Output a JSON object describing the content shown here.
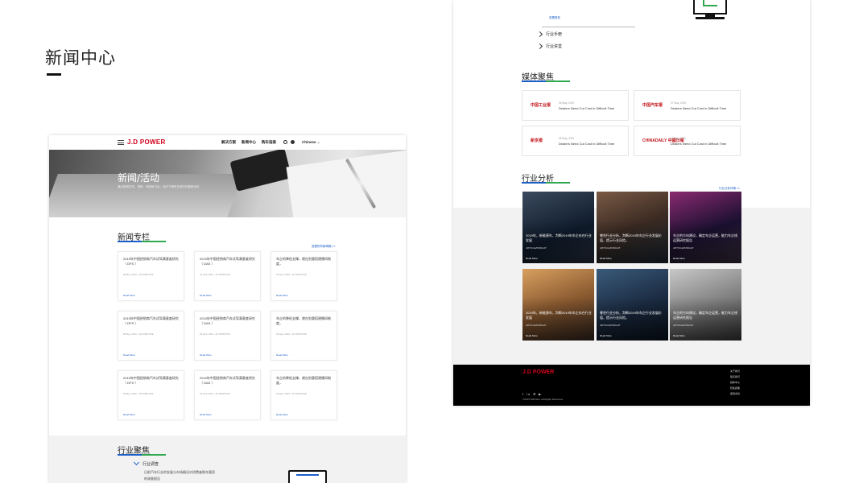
{
  "page": {
    "title": "新闻中心"
  },
  "left": {
    "nav": {
      "logo": "J.D POWER",
      "links": [
        "解决方案",
        "新闻中心",
        "购车指南"
      ],
      "lang": "Chinese"
    },
    "hero": {
      "title": "新闻/活动",
      "subtitle": "通过新闻发布，调研，网络研讨会，及时了解有关我们的最新动态"
    },
    "column": {
      "title": "新闻专栏",
      "more": "查看所有新闻稿 >>",
      "cards": [
        {
          "title": "2019年中国经销商汽车试驾满意度研究（ DFS ）",
          "date": "08 May, 2019 · AUTOMOTIVE",
          "read": "Read More"
        },
        {
          "title": "2019年中国经销商汽车试驾满意度研究（ DAS ）",
          "date": "23 April, 2019 · AUTOMOTIVE",
          "read": "Read More"
        },
        {
          "title": "车企的降低支撑，就在别惠搭建播间制度，",
          "date": "04 April, 2019 · AUTOMOTIVE",
          "read": "Read More"
        },
        {
          "title": "2019年中国经销商汽车试驾满意度研究（ DFS ）",
          "date": "08 May, 2019 · AUTOMOTIVE",
          "read": "Read More"
        },
        {
          "title": "2019年中国经销商汽车试驾满意度研究（ DAS ）",
          "date": "23 April, 2019 · AUTOMOTIVE",
          "read": "Read More"
        },
        {
          "title": "车企的降低支撑，就在别惠搭建播间制度，",
          "date": "04 April, 2019 · AUTOMOTIVE",
          "read": "Read More"
        },
        {
          "title": "2019年中国经销商汽车试驾满意度研究（ DFS ）",
          "date": "08 May, 2019 · AUTOMOTIVE",
          "read": "Read More"
        },
        {
          "title": "2019年中国经销商汽车试驾满意度研究（ DAS ）",
          "date": "23 April, 2019 · AUTOMOTIVE",
          "read": "Read More"
        },
        {
          "title": "车企的降低支撑，就在别惠搭建播间制度，",
          "date": "04 April, 2019 · AUTOMOTIVE",
          "read": "Read More"
        }
      ]
    },
    "industry": {
      "title": "行业聚焦",
      "tree_item": "行业调查",
      "sub1": "日前汽车行业的发展与市场概况对消费者购车意愿",
      "sub2": "的调查报告"
    }
  },
  "right": {
    "top": {
      "small_link": "查看报告",
      "items": [
        "行业手册",
        "行业讲堂"
      ]
    },
    "media": {
      "title": "媒体聚焦",
      "cards": [
        {
          "logo": "中国工业报",
          "date": "05 May, 2019",
          "title": "Dealers Need Cut Cost in Difficult Time"
        },
        {
          "logo": "中国汽车报",
          "date": "07 May, 2019",
          "title": "Dealers Need Cut Cost in Difficult Time"
        },
        {
          "logo": "新京报",
          "date": "06 May, 2019",
          "title": "Dealers Need Cut Cost in Difficult Time"
        },
        {
          "logo": "CHINADAILY 中國日報",
          "date": "11 May, 2019",
          "title": "Dealers Need Cut Cost in Difficult Time"
        }
      ]
    },
    "analysis": {
      "title": "行业分析",
      "more": "行业分析详情 >>",
      "tiles": [
        {
          "title": "2019年，新能源车，判断2019年车企存在行业发展",
          "cat": "ARTICLE/INSIGHT",
          "read": "Read More"
        },
        {
          "title": "哪些行业分析，判断2019年车企行业发展价值，提示行业风险。",
          "cat": "ARTICLE/INSIGHT",
          "read": "Read More"
        },
        {
          "title": "车企的方向建议，确定车企运营，能力车企线运营研究报告",
          "cat": "ARTICLE/INSIGHT",
          "read": "Read More"
        },
        {
          "title": "2019年，新能源车，判断2019年车企存在行业发展",
          "cat": "ARTICLE/INSIGHT",
          "read": "Read More"
        },
        {
          "title": "哪些行业分析，判断2019年车企行业发展价值，提示行业风险。",
          "cat": "ARTICLE/INSIGHT",
          "read": "Read More"
        },
        {
          "title": "车企的方向建议，确定车企运营，能力车企线运营研究报告",
          "cat": "ARTICLE/INSIGHT",
          "read": "Read More"
        }
      ]
    },
    "footer": {
      "logo": "J.D POWER",
      "social": "f in ☰ ▶",
      "copy": "©2019 JDPower. All Rights Reserved.",
      "links": [
        "关于我们",
        "联系我们",
        "媒体中心",
        "隐私政策",
        "使用条款"
      ]
    }
  }
}
